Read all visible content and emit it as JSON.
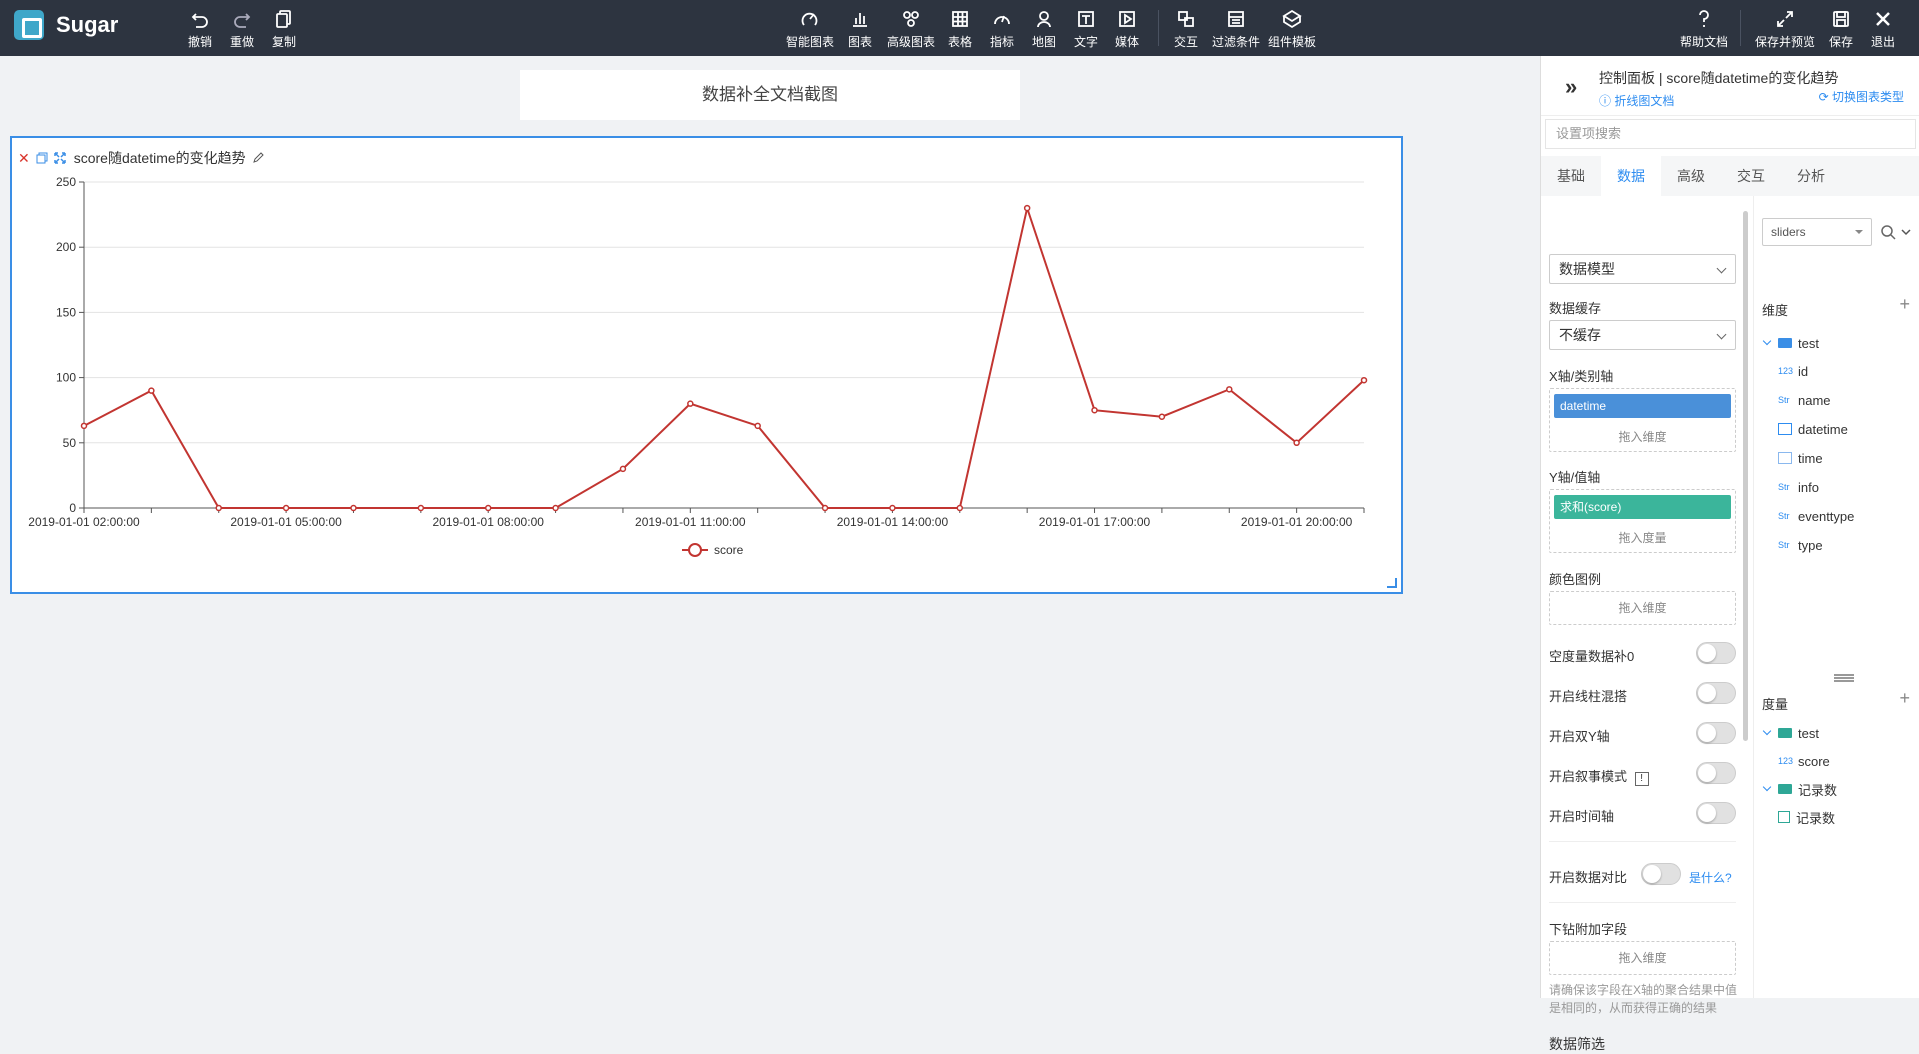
{
  "app": {
    "name": "Sugar"
  },
  "toolbar_left": [
    {
      "label": "撤销",
      "icon": "undo-icon"
    },
    {
      "label": "重做",
      "icon": "redo-icon"
    },
    {
      "label": "复制",
      "icon": "copy-icon"
    }
  ],
  "toolbar_center": [
    {
      "label": "智能图表",
      "icon": "smart-chart-icon"
    },
    {
      "label": "图表",
      "icon": "bar-chart-icon"
    },
    {
      "label": "高级图表",
      "icon": "advanced-chart-icon"
    },
    {
      "label": "表格",
      "icon": "table-icon"
    },
    {
      "label": "指标",
      "icon": "gauge-icon"
    },
    {
      "label": "地图",
      "icon": "map-pin-icon"
    },
    {
      "label": "文字",
      "icon": "text-icon"
    },
    {
      "label": "媒体",
      "icon": "media-icon"
    },
    {
      "label": "交互",
      "icon": "interaction-icon"
    },
    {
      "label": "过滤条件",
      "icon": "filter-icon"
    },
    {
      "label": "组件模板",
      "icon": "template-icon"
    }
  ],
  "toolbar_right": [
    {
      "label": "帮助文档",
      "icon": "help-icon"
    },
    {
      "label": "保存并预览",
      "icon": "expand-icon"
    },
    {
      "label": "保存",
      "icon": "save-icon"
    },
    {
      "label": "退出",
      "icon": "close-icon"
    }
  ],
  "canvas": {
    "report_title": "数据补全文档截图"
  },
  "widget": {
    "title": "score随datetime的变化趋势"
  },
  "chart_data": {
    "type": "line",
    "title": "score随datetime的变化趋势",
    "x": [
      "2019-01-01 02:00:00",
      "2019-01-01 03:00:00",
      "2019-01-01 04:00:00",
      "2019-01-01 05:00:00",
      "2019-01-01 06:00:00",
      "2019-01-01 07:00:00",
      "2019-01-01 08:00:00",
      "2019-01-01 09:00:00",
      "2019-01-01 10:00:00",
      "2019-01-01 11:00:00",
      "2019-01-01 12:00:00",
      "2019-01-01 13:00:00",
      "2019-01-01 14:00:00",
      "2019-01-01 15:00:00",
      "2019-01-01 16:00:00",
      "2019-01-01 17:00:00",
      "2019-01-01 18:00:00",
      "2019-01-01 19:00:00",
      "2019-01-01 20:00:00",
      "2019-01-01 21:00:00"
    ],
    "x_tick_labels": [
      "2019-01-01 02:00:00",
      "2019-01-01 05:00:00",
      "2019-01-01 08:00:00",
      "2019-01-01 11:00:00",
      "2019-01-01 14:00:00",
      "2019-01-01 17:00:00",
      "2019-01-01 20:00:00"
    ],
    "series": [
      {
        "name": "score",
        "values": [
          63,
          90,
          0,
          0,
          0,
          0,
          0,
          0,
          30,
          80,
          63,
          0,
          0,
          0,
          230,
          75,
          70,
          91,
          50,
          98
        ],
        "color": "#c23531"
      }
    ],
    "ylim": [
      0,
      250
    ],
    "y_ticks": [
      0,
      50,
      100,
      150,
      200,
      250
    ],
    "grid": true,
    "legend": "bottom-center"
  },
  "panel": {
    "title": "控制面板 | score随datetime的变化趋势",
    "doc_link": "折线图文档",
    "switch_link": "切换图表类型",
    "search_placeholder": "设置项搜索",
    "tabs": [
      "基础",
      "数据",
      "高级",
      "交互",
      "分析"
    ],
    "active_tab": "数据",
    "model_select": "数据模型",
    "cache_label": "数据缓存",
    "cache_value": "不缓存",
    "x_axis_label": "X轴/类别轴",
    "x_chip": "datetime",
    "drop_dim": "拖入维度",
    "y_axis_label": "Y轴/值轴",
    "y_chip": "求和(score)",
    "drop_measure": "拖入度量",
    "color_legend": "颜色图例",
    "toggles": [
      "空度量数据补0",
      "开启线柱混搭",
      "开启双Y轴",
      "开启叙事模式",
      "开启时间轴"
    ],
    "compare_label": "开启数据对比",
    "compare_what": "是什么?",
    "drill_label": "下钻附加字段",
    "drill_hint": "请确保该字段在X轴的聚合结果中值是相同的，从而获得正确的结果",
    "filter_label": "数据筛选",
    "colors": {
      "x_chip": "#4a90d9",
      "y_chip": "#3bb59b",
      "accent": "#2d8cf0"
    }
  },
  "fields": {
    "source_select": "sliders",
    "dim_title": "维度",
    "dim_table": "test",
    "dims": [
      {
        "type": "123",
        "name": "id"
      },
      {
        "type": "Str",
        "name": "name"
      },
      {
        "type": "date",
        "name": "datetime"
      },
      {
        "type": "time",
        "name": "time"
      },
      {
        "type": "Str",
        "name": "info"
      },
      {
        "type": "Str",
        "name": "eventtype"
      },
      {
        "type": "Str",
        "name": "type"
      }
    ],
    "measure_title": "度量",
    "measure_table": "test",
    "measures": [
      {
        "type": "123",
        "name": "score"
      }
    ],
    "count_group": "记录数",
    "count_item": "记录数"
  }
}
